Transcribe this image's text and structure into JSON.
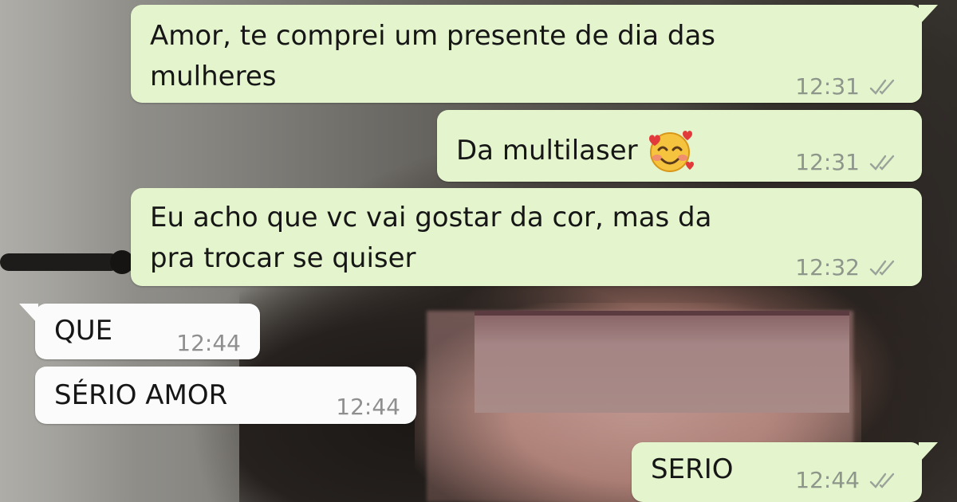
{
  "conversation": {
    "messages": [
      {
        "direction": "outgoing",
        "lines": [
          "Amor, te comprei um presente de dia das",
          "mulheres"
        ],
        "time": "12:31",
        "status_icon": "double-check-icon"
      },
      {
        "direction": "outgoing",
        "lines": [
          "Da multilaser"
        ],
        "emoji": "smiling-face-with-hearts",
        "time": "12:31",
        "status_icon": "double-check-icon"
      },
      {
        "direction": "outgoing",
        "lines": [
          "Eu acho que vc vai gostar da cor, mas da",
          "pra trocar se quiser"
        ],
        "time": "12:32",
        "status_icon": "double-check-icon"
      },
      {
        "direction": "incoming",
        "lines": [
          "QUE"
        ],
        "time": "12:44"
      },
      {
        "direction": "incoming",
        "lines": [
          "SÉRIO AMOR"
        ],
        "time": "12:44"
      },
      {
        "direction": "outgoing",
        "lines": [
          "SERIO"
        ],
        "time": "12:44",
        "status_icon": "double-check-icon"
      }
    ]
  },
  "colors": {
    "outgoing_bubble": "#e4f5cd",
    "incoming_bubble": "#fbfbfb",
    "timestamp": "#8e968c"
  }
}
